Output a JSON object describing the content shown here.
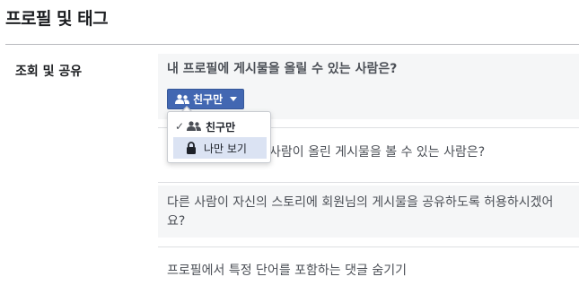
{
  "page": {
    "title": "프로필 및 태그"
  },
  "section": {
    "label": "조회 및 공유"
  },
  "settings": [
    {
      "question": "내 프로필에 게시물을 올릴 수 있는 사람은?"
    },
    {
      "question": "사람이 올린 게시물을 볼 수 있는 사람은?"
    },
    {
      "question": "다른 사람이 자신의 스토리에 회원님의 게시물을 공유하도록 허용하시겠어요?"
    },
    {
      "question": "프로필에서 특정 단어를 포함하는 댓글 숨기기"
    }
  ],
  "privacy_button": {
    "label": "친구만",
    "icon": "friends-icon"
  },
  "dropdown": {
    "options": [
      {
        "label": "친구만",
        "icon": "friends-icon",
        "checked": true
      },
      {
        "label": "나만 보기",
        "icon": "lock-icon",
        "highlighted": true
      }
    ]
  },
  "colors": {
    "accent": "#4267b2",
    "highlight": "#dbe3f3",
    "panel_bg": "#f5f6f7"
  }
}
